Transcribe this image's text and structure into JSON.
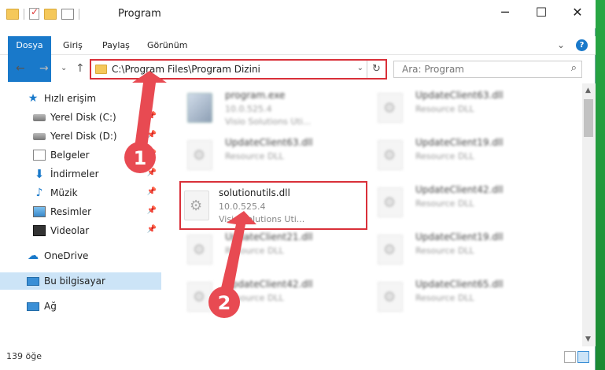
{
  "window": {
    "title": "Program",
    "minimize": "─",
    "maximize": "☐",
    "close": "✕"
  },
  "ribbon": {
    "tabs": [
      "Dosya",
      "Giriş",
      "Paylaş",
      "Görünüm"
    ],
    "collapse": "⌄",
    "help": "?"
  },
  "nav": {
    "back": "←",
    "forward": "→",
    "recent": "⌄",
    "up": "↑",
    "address": "C:\\Program Files\\Program Dizini",
    "address_dropdown": "⌄",
    "refresh": "↻",
    "search_placeholder": "Ara: Program",
    "search_icon": "⌕"
  },
  "sidebar": {
    "pin": "📌",
    "items": [
      {
        "label": "Hızlı erişim",
        "icon": "star-icon"
      },
      {
        "label": "Yerel Disk (C:)",
        "icon": "disk-icon"
      },
      {
        "label": "Yerel Disk (D:)",
        "icon": "disk-icon"
      },
      {
        "label": "Belgeler",
        "icon": "document-icon"
      },
      {
        "label": "İndirmeler",
        "icon": "download-icon"
      },
      {
        "label": "Müzik",
        "icon": "music-icon"
      },
      {
        "label": "Resimler",
        "icon": "pictures-icon"
      },
      {
        "label": "Videolar",
        "icon": "videos-icon"
      },
      {
        "label": "OneDrive",
        "icon": "cloud-icon"
      },
      {
        "label": "Bu bilgisayar",
        "icon": "computer-icon"
      },
      {
        "label": "Ağ",
        "icon": "network-icon"
      }
    ]
  },
  "files": [
    {
      "name": "program.exe",
      "line2": "10.0.525.4",
      "line3": "Visio Solutions Uti..."
    },
    {
      "name": "UpdateClient63.dll",
      "line2": "Resource DLL",
      "line3": ""
    },
    {
      "name": "UpdateClient63.dll",
      "line2": "Resource DLL",
      "line3": ""
    },
    {
      "name": "UpdateClient19.dll",
      "line2": "Resource DLL",
      "line3": ""
    },
    {
      "name": "solutionutils.dll",
      "line2": "10.0.525.4",
      "line3": "Visio Solutions Uti..."
    },
    {
      "name": "UpdateClient42.dll",
      "line2": "Resource DLL",
      "line3": ""
    },
    {
      "name": "UpdateClient21.dll",
      "line2": "Resource DLL",
      "line3": ""
    },
    {
      "name": "UpdateClient19.dll",
      "line2": "Resource DLL",
      "line3": ""
    },
    {
      "name": "UpdateClient42.dll",
      "line2": "Resource DLL",
      "line3": ""
    },
    {
      "name": "UpdateClient65.dll",
      "line2": "Resource DLL",
      "line3": ""
    }
  ],
  "status": {
    "count": "139 öğe"
  },
  "callouts": {
    "one": "1",
    "two": "2",
    "color": "#e84a52"
  }
}
